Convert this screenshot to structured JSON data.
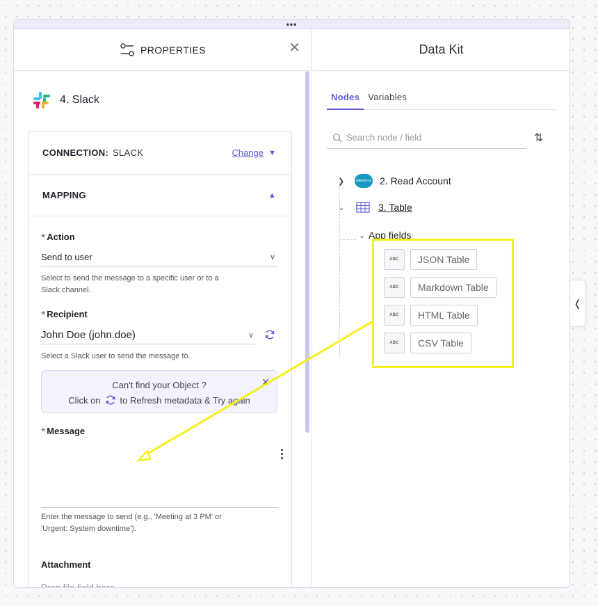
{
  "window": {
    "drag_handle": "•••"
  },
  "properties": {
    "title": "PROPERTIES",
    "node_title": "4. Slack",
    "connection": {
      "label": "CONNECTION:",
      "value": "SLACK",
      "change_label": "Change"
    },
    "mapping_label": "MAPPING",
    "action": {
      "label": "Action",
      "value": "Send to user",
      "help_line1": "Select to send the message to a specific user or to a",
      "help_line2": "Slack channel."
    },
    "recipient": {
      "label": "Recipient",
      "value": "John Doe (john.doe)",
      "help": "Select a Slack user to send the message to."
    },
    "info": {
      "line1": "Can't find your Object ?",
      "line2_a": "Click on",
      "line2_b": "to Refresh metadata & Try again"
    },
    "message": {
      "label": "Message",
      "help_line1": "Enter the message to send (e.g., 'Meeting at 3 PM' or",
      "help_line2": "'Urgent: System downtime')."
    },
    "attachment": {
      "label": "Attachment",
      "placeholder": "Drop file field here"
    }
  },
  "datakit": {
    "title": "Data Kit",
    "tabs": [
      "Nodes",
      "Variables"
    ],
    "search_placeholder": "Search node / field",
    "tree": {
      "node1": "2. Read Account",
      "node2": "3. Table",
      "group": "App fields",
      "fields": [
        "JSON Table",
        "Markdown Table",
        "HTML Table",
        "CSV Table"
      ],
      "field_type": "ABC"
    }
  },
  "colors": {
    "accent": "#5b5bd6",
    "highlight": "#f5ef1b"
  }
}
